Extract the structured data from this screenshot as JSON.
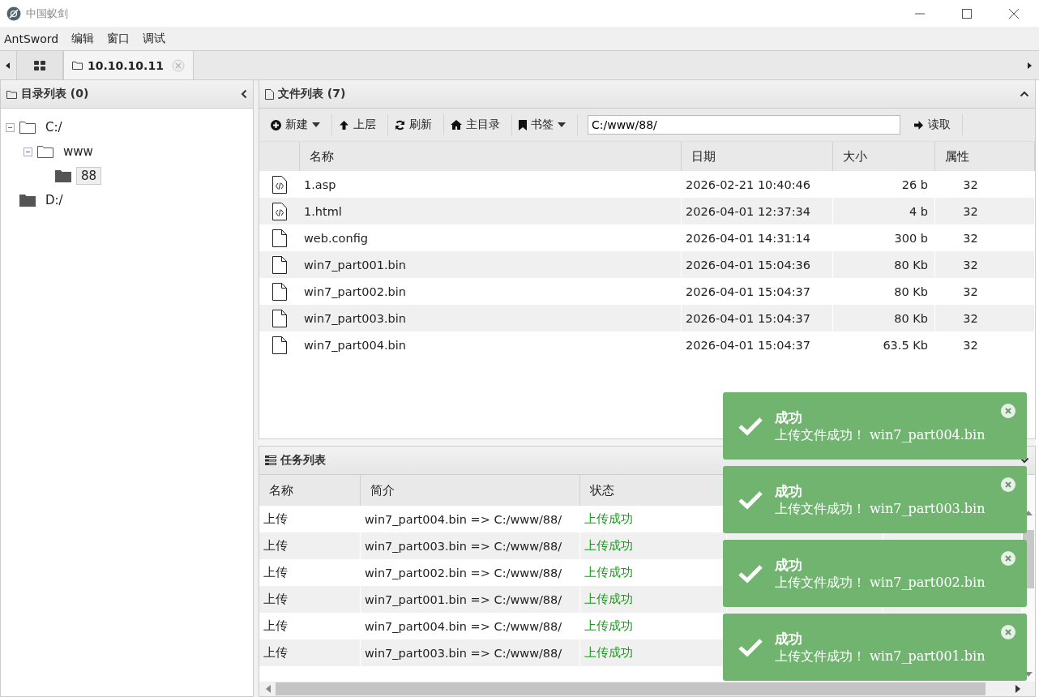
{
  "window": {
    "title": "中国蚁剑"
  },
  "menu": [
    "AntSword",
    "编辑",
    "窗口",
    "调试"
  ],
  "tabs": [
    {
      "kind": "home",
      "selected": false
    },
    {
      "kind": "folder",
      "label": "10.10.10.11",
      "selected": true
    }
  ],
  "dir_panel": {
    "title": "目录列表 (0)",
    "tree": [
      {
        "label": "C:/",
        "expanded": true,
        "selected": false,
        "children": [
          {
            "label": "www",
            "expanded": true,
            "selected": false,
            "children": [
              {
                "label": "88",
                "expanded": false,
                "selected": true
              }
            ]
          }
        ]
      },
      {
        "label": "D:/",
        "expanded": false,
        "selected": false
      }
    ]
  },
  "file_panel": {
    "title": "文件列表 (7)",
    "toolbar": [
      {
        "kind": "new",
        "label": "新建",
        "dropdown": true
      },
      {
        "kind": "up",
        "label": "上层",
        "dropdown": false
      },
      {
        "kind": "refresh",
        "label": "刷新",
        "dropdown": false
      },
      {
        "kind": "home",
        "label": "主目录",
        "dropdown": false
      },
      {
        "kind": "bookmark",
        "label": "书签",
        "dropdown": true
      }
    ],
    "path": "C:/www/88/",
    "read_button": "读取",
    "columns": [
      "名称",
      "日期",
      "大小",
      "属性"
    ],
    "rows": [
      {
        "kind": "code",
        "name": "1.asp",
        "date": "2026-02-21 10:40:46",
        "size": "26 b",
        "attr": "32"
      },
      {
        "kind": "code",
        "name": "1.html",
        "date": "2026-04-01 12:37:34",
        "size": "4 b",
        "attr": "32"
      },
      {
        "kind": "file",
        "name": "web.config",
        "date": "2026-04-01 14:31:14",
        "size": "300 b",
        "attr": "32"
      },
      {
        "kind": "file",
        "name": "win7_part001.bin",
        "date": "2026-04-01 15:04:36",
        "size": "80 Kb",
        "attr": "32"
      },
      {
        "kind": "file",
        "name": "win7_part002.bin",
        "date": "2026-04-01 15:04:37",
        "size": "80 Kb",
        "attr": "32"
      },
      {
        "kind": "file",
        "name": "win7_part003.bin",
        "date": "2026-04-01 15:04:37",
        "size": "80 Kb",
        "attr": "32"
      },
      {
        "kind": "file",
        "name": "win7_part004.bin",
        "date": "2026-04-01 15:04:37",
        "size": "63.5 Kb",
        "attr": "32"
      }
    ]
  },
  "task_panel": {
    "title": "任务列表",
    "columns": [
      "名称",
      "简介",
      "状态"
    ],
    "rows": [
      [
        "上传",
        "win7_part004.bin => C:/www/88/",
        "上传成功"
      ],
      [
        "上传",
        "win7_part003.bin => C:/www/88/",
        "上传成功"
      ],
      [
        "上传",
        "win7_part002.bin => C:/www/88/",
        "上传成功"
      ],
      [
        "上传",
        "win7_part001.bin => C:/www/88/",
        "上传成功"
      ],
      [
        "上传",
        "win7_part004.bin => C:/www/88/",
        "上传成功"
      ],
      [
        "上传",
        "win7_part003.bin => C:/www/88/",
        "上传成功"
      ]
    ]
  },
  "toasts": [
    {
      "title": "成功",
      "message": "上传文件成功！ win7_part004.bin"
    },
    {
      "title": "成功",
      "message": "上传文件成功！ win7_part003.bin"
    },
    {
      "title": "成功",
      "message": "上传文件成功！ win7_part002.bin"
    },
    {
      "title": "成功",
      "message": "上传文件成功！ win7_part001.bin"
    }
  ]
}
